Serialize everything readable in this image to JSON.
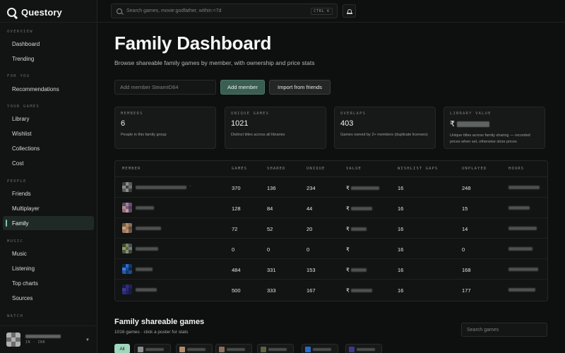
{
  "brand": {
    "name": "Questory"
  },
  "topbar": {
    "search_placeholder": "Search games, movie:godfather, within:<7d",
    "shortcut": "CTRL K"
  },
  "sidebar": {
    "sections": [
      {
        "title": "OVERVIEW",
        "items": [
          {
            "label": "Dashboard"
          },
          {
            "label": "Trending"
          }
        ]
      },
      {
        "title": "FOR YOU",
        "items": [
          {
            "label": "Recommendations"
          }
        ]
      },
      {
        "title": "YOUR GAMES",
        "items": [
          {
            "label": "Library"
          },
          {
            "label": "Wishlist"
          },
          {
            "label": "Collections"
          },
          {
            "label": "Cost"
          }
        ]
      },
      {
        "title": "PEOPLE",
        "items": [
          {
            "label": "Friends"
          },
          {
            "label": "Multiplayer"
          },
          {
            "label": "Family",
            "active": true
          }
        ]
      },
      {
        "title": "MUSIC",
        "items": [
          {
            "label": "Music"
          },
          {
            "label": "Listening"
          },
          {
            "label": "Top charts"
          },
          {
            "label": "Sources"
          }
        ]
      },
      {
        "title": "WATCH",
        "items": []
      }
    ],
    "user_sub": "IN · INR"
  },
  "page": {
    "title": "Family Dashboard",
    "subtitle": "Browse shareable family games by member, with ownership and price stats",
    "member_input_placeholder": "Add member SteamID64",
    "add_member_label": "Add member",
    "import_label": "Import from friends"
  },
  "stats": [
    {
      "label": "MEMBERS",
      "value": "6",
      "desc": "People in this family group"
    },
    {
      "label": "UNIQUE GAMES",
      "value": "1021",
      "desc": "Distinct titles across all libraries"
    },
    {
      "label": "OVERLAPS",
      "value": "403",
      "desc": "Games owned by 2+ members (duplicate licenses)"
    },
    {
      "label": "LIBRARY VALUE",
      "value": "₹",
      "desc": "Unique titles across family sharing — recorded prices when set, otherwise store prices",
      "blurred": true
    }
  ],
  "table": {
    "columns": [
      "MEMBER",
      "GAMES",
      "SHARED",
      "UNIQUE",
      "VALUE",
      "WISHLIST GAPS",
      "UNPLAYED",
      "HOURS"
    ],
    "currency": "₹",
    "rows": [
      {
        "games": "370",
        "shared": "136",
        "unique": "234",
        "wishlist_gaps": "16",
        "unplayed": "248",
        "avatar": [
          "#3d3f3e",
          "#8a8c8b",
          "#5a5c5b",
          "#8a8c8b",
          "#3d3f3e",
          "#6e706f",
          "#5a5c5b",
          "#8a8c8b",
          "#3d3f3e"
        ]
      },
      {
        "games": "128",
        "shared": "84",
        "unique": "44",
        "wishlist_gaps": "16",
        "unplayed": "15",
        "avatar": [
          "#5a4a6a",
          "#9c7fa0",
          "#6a5070",
          "#b38b8b",
          "#7a5a78",
          "#4f3e5a",
          "#8e6e8a",
          "#c19a9a",
          "#5a4a6a"
        ]
      },
      {
        "games": "72",
        "shared": "52",
        "unique": "20",
        "wishlist_gaps": "16",
        "unplayed": "14",
        "avatar": [
          "#6e5a4a",
          "#b08a6a",
          "#8a6e58",
          "#c9a07a",
          "#a07a5c",
          "#5c4a3e",
          "#9a7a62",
          "#b89070",
          "#6e5a4a"
        ]
      },
      {
        "games": "0",
        "shared": "0",
        "unique": "0",
        "wishlist_gaps": "16",
        "unplayed": "0",
        "avatar": [
          "#3e4a2e",
          "#7a8a5a",
          "#4a4e5a",
          "#8c9a6a",
          "#5a6240",
          "#6e7a8a",
          "#4e5a3a",
          "#8a8e7a",
          "#3e4a2e"
        ]
      },
      {
        "games": "484",
        "shared": "331",
        "unique": "153",
        "wishlist_gaps": "16",
        "unplayed": "168",
        "avatar": [
          "#0e2a4a",
          "#2a6acb",
          "#123a6a",
          "#3a7ad8",
          "#1a4a9a",
          "#0e2a4a",
          "#2a5aa8",
          "#123a6a",
          "#1a4a9a"
        ]
      },
      {
        "games": "500",
        "shared": "333",
        "unique": "167",
        "wishlist_gaps": "16",
        "unplayed": "177",
        "avatar": [
          "#1a1a4a",
          "#2e2e7a",
          "#22225e",
          "#3a3a8a",
          "#2a2a6e",
          "#1a1a4a",
          "#2e2e7a",
          "#22225e",
          "#1a1a4a"
        ]
      }
    ]
  },
  "shareable": {
    "title": "Family shareable games",
    "subtitle": "1016 games · click a poster for stats",
    "search_placeholder": "Search games",
    "all_chip": "All",
    "chip_colors": [
      "#8a8c8b",
      "#b08a6a",
      "#8a6e58",
      "#5a6240",
      "#2a6acb",
      "#3a3a8a"
    ]
  },
  "colors": {
    "accent": "#7fc7a6",
    "primary_button": "#3a5e51",
    "chip_active": "#9ed7bc"
  }
}
